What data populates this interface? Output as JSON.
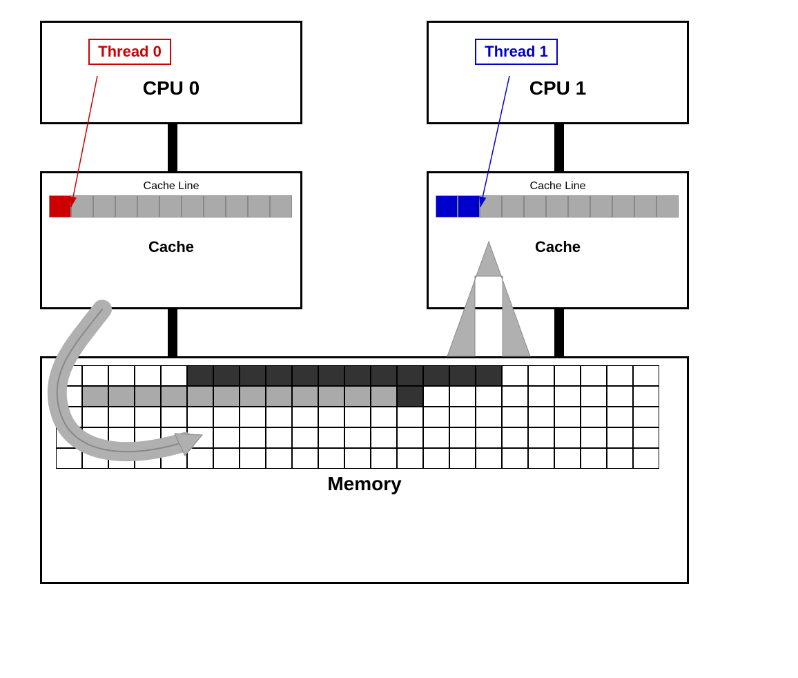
{
  "threads": [
    {
      "label": "Thread 0",
      "color": "red"
    },
    {
      "label": "Thread 1",
      "color": "blue"
    }
  ],
  "cpus": [
    {
      "label": "CPU 0"
    },
    {
      "label": "CPU 1"
    }
  ],
  "caches": [
    {
      "label": "Cache",
      "line_label": "Cache Line"
    },
    {
      "label": "Cache",
      "line_label": "Cache Line"
    }
  ],
  "memory": {
    "label": "Memory"
  },
  "colors": {
    "red": "#cc0000",
    "blue": "#0000cc",
    "gray_cell": "#aaaaaa",
    "connector": "#000000",
    "big_arrow": "#b0b0b0"
  }
}
